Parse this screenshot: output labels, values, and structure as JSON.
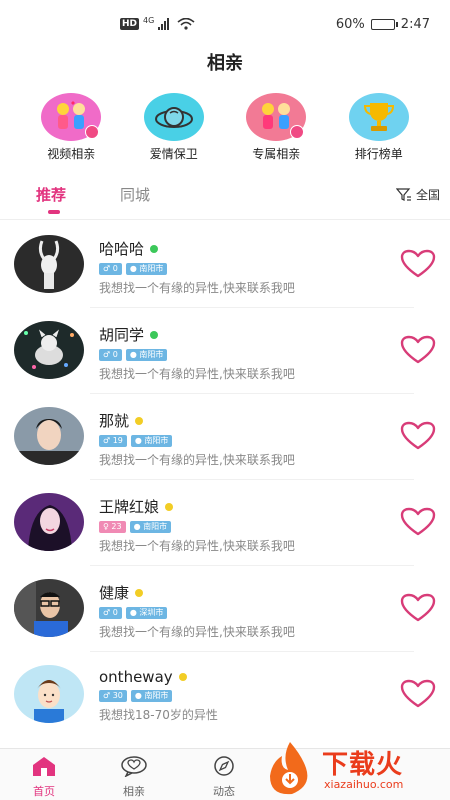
{
  "status_bar": {
    "hd": "HD",
    "network": "4G",
    "battery_pct": "60%",
    "time": "2:47",
    "battery_level": 0.6
  },
  "title": "相亲",
  "features": [
    {
      "label": "视频相亲",
      "icon": "video-date-icon",
      "color": "#f06bc8"
    },
    {
      "label": "爱情保卫",
      "icon": "love-guard-icon",
      "color": "#49d0e6"
    },
    {
      "label": "专属相亲",
      "icon": "exclusive-date-icon",
      "color": "#f27a95"
    },
    {
      "label": "排行榜单",
      "icon": "ranking-trophy-icon",
      "color": "#6fd2f0"
    }
  ],
  "tabs": [
    {
      "label": "推荐"
    },
    {
      "label": "同城"
    }
  ],
  "filter": {
    "label": "全国",
    "icon": "filter-icon"
  },
  "users": [
    {
      "name": "哈哈哈",
      "status_color": "#3cc85a",
      "gender": "♂",
      "age": "0",
      "city": "南阳市",
      "bio": "我想找一个有缘的异性,快来联系我吧"
    },
    {
      "name": "胡同学",
      "status_color": "#3cc85a",
      "gender": "♂",
      "age": "0",
      "city": "南阳市",
      "bio": "我想找一个有缘的异性,快来联系我吧"
    },
    {
      "name": "那就",
      "status_color": "#f2cd25",
      "gender": "♂",
      "age": "19",
      "city": "南阳市",
      "bio": "我想找一个有缘的异性,快来联系我吧"
    },
    {
      "name": "王牌红娘",
      "status_color": "#f2cd25",
      "gender": "♀",
      "age": "23",
      "city": "南阳市",
      "bio": "我想找一个有缘的异性,快来联系我吧"
    },
    {
      "name": "健康",
      "status_color": "#f2cd25",
      "gender": "♂",
      "age": "0",
      "city": "深圳市",
      "bio": "我想找一个有缘的异性,快来联系我吧"
    },
    {
      "name": "ontheway",
      "status_color": "#f2cd25",
      "gender": "♂",
      "age": "30",
      "city": "南阳市",
      "bio": "我想找18-70岁的异性"
    }
  ],
  "bottom_nav": [
    {
      "label": "首页"
    },
    {
      "label": "相亲"
    },
    {
      "label": "动态"
    }
  ],
  "watermark": {
    "text": "下载火",
    "url": "xiazaihuo.com"
  },
  "colors": {
    "accent": "#e2347f",
    "heart": "#d83c78",
    "tag_blue": "#6db6e3",
    "tag_pink": "#f08ab4"
  }
}
